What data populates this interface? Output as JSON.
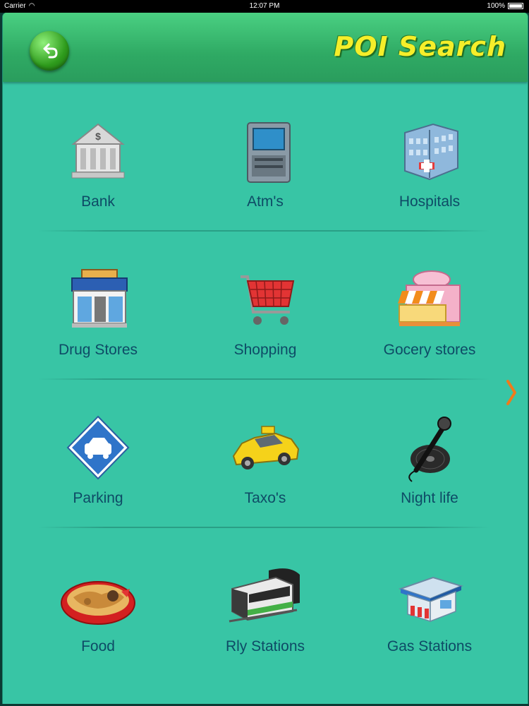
{
  "status": {
    "carrier": "Carrier",
    "time": "12:07 PM",
    "battery": "100%"
  },
  "header": {
    "title": "POI Search",
    "back_icon": "back-arrow-icon"
  },
  "categories": [
    [
      {
        "label": "Bank",
        "icon": "bank-icon"
      },
      {
        "label": "Atm's",
        "icon": "atm-icon"
      },
      {
        "label": "Hospitals",
        "icon": "hospital-icon"
      }
    ],
    [
      {
        "label": "Drug Stores",
        "icon": "drugstore-icon"
      },
      {
        "label": "Shopping",
        "icon": "shopping-cart-icon"
      },
      {
        "label": "Gocery stores",
        "icon": "grocery-store-icon"
      }
    ],
    [
      {
        "label": "Parking",
        "icon": "parking-icon"
      },
      {
        "label": "Taxo's",
        "icon": "taxi-icon"
      },
      {
        "label": "Night life",
        "icon": "microphone-icon"
      }
    ],
    [
      {
        "label": "Food",
        "icon": "food-icon"
      },
      {
        "label": "Rly Stations",
        "icon": "train-icon"
      },
      {
        "label": "Gas Stations",
        "icon": "gas-station-icon"
      }
    ]
  ],
  "colors": {
    "background": "#38c5a5",
    "header": "#2faa64",
    "title": "#f5ee2a",
    "label": "#0e4b66",
    "arrow": "#f07a1a"
  }
}
